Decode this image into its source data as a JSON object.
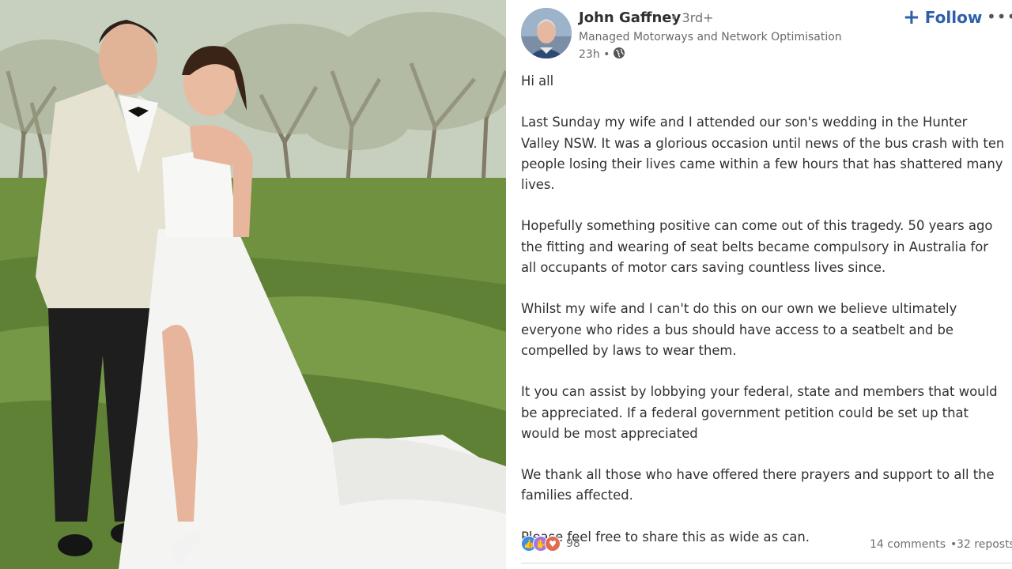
{
  "author": {
    "name": "John Gaffney",
    "degree": "• 3rd+",
    "headline": "Managed Motorways and Network Optimisation",
    "timestamp": "23h •",
    "visibility_icon": "globe-icon"
  },
  "actions": {
    "follow_label": "Follow",
    "follow_icon": "plus-icon",
    "more_label": "•••"
  },
  "post": {
    "paragraphs": [
      "Hi all",
      "Last Sunday my wife and I attended our son's wedding in the Hunter Valley NSW. It was a glorious occasion until news of the bus crash with ten people losing their lives came within a few hours that has shattered many lives.",
      "Hopefully something positive can come out of this tragedy. 50 years ago the fitting and wearing of seat belts became compulsory in Australia for all occupants of motor cars saving countless lives since.",
      "Whilst my wife and I can't do this on our own we believe ultimately everyone who rides a bus should have access to a seatbelt and be compelled by laws to wear them.",
      "It you can assist by lobbying your federal, state and members that would be appreciated. If a federal government petition could be set up that would be most appreciated",
      "We thank all those who have offered there prayers and support to all the families affected.",
      "Please feel free to share this as wide as can."
    ]
  },
  "social": {
    "reaction_icons": [
      "like-icon",
      "support-icon",
      "love-icon"
    ],
    "reaction_count": "98",
    "comments": "14 comments",
    "separator": "•",
    "reposts": "32 reposts"
  },
  "colors": {
    "follow_blue": "#2f5fa9",
    "text_primary": "#303030",
    "text_secondary": "#6a6a6a"
  }
}
